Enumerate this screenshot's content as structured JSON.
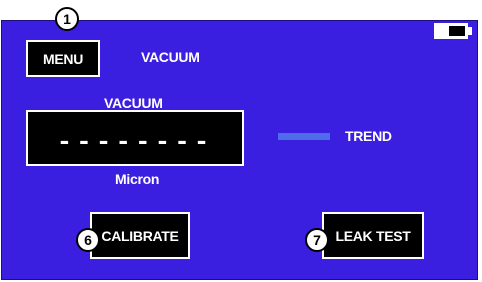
{
  "header": {
    "menu_label": "MENU",
    "title": "VACUUM"
  },
  "display": {
    "heading": "VACUUM",
    "reading": "--------",
    "unit": "Micron"
  },
  "trend": {
    "label": "TREND"
  },
  "actions": {
    "calibrate_label": "CALIBRATE",
    "leak_test_label": "LEAK TEST"
  },
  "callouts": {
    "menu": "1",
    "calibrate": "6",
    "leak_test": "7"
  },
  "status": {
    "battery_icon": "battery-icon"
  },
  "colors": {
    "screen_background": "#3a1fe0",
    "button_background": "#000000",
    "text": "#ffffff",
    "trend_bar": "#4e6be8"
  }
}
